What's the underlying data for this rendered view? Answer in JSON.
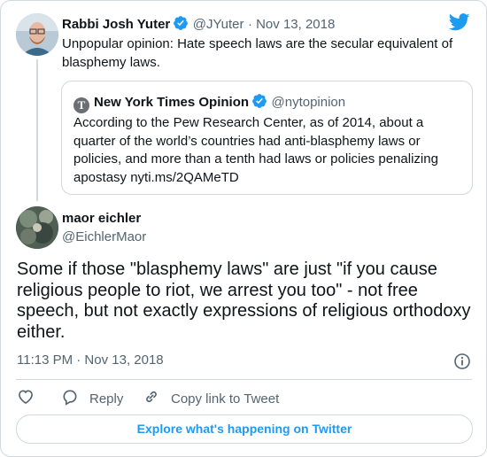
{
  "parent_tweet": {
    "author_name": "Rabbi Josh Yuter",
    "handle": "@JYuter",
    "date": "· Nov 13, 2018",
    "text": "Unpopular opinion: Hate speech laws are the secular equivalent of blasphemy laws.",
    "quoted": {
      "author_name": "New York Times Opinion",
      "handle": "@nytopinion",
      "logo_letter": "T",
      "text": "According to the Pew Research Center, as of 2014, about a quarter of the world’s countries had anti-blasphemy laws or policies, and more than a tenth had laws or policies penalizing apostasy nyti.ms/2QAMeTD"
    }
  },
  "reply_tweet": {
    "author_name": "maor eichler",
    "handle": "@EichlerMaor",
    "text": "Some if those \"blasphemy laws\" are just \"if you cause religious people to riot, we arrest you too\" - not free speech, but not exactly expressions of religious orthodoxy either.",
    "timestamp": "11:13 PM · Nov 13, 2018"
  },
  "actions": {
    "reply_label": "Reply",
    "copy_link_label": "Copy link to Tweet"
  },
  "explore_button": "Explore what's happening on Twitter",
  "colors": {
    "accent": "#1d9bf0",
    "secondary_text": "#536471",
    "border": "#cfd9de"
  }
}
